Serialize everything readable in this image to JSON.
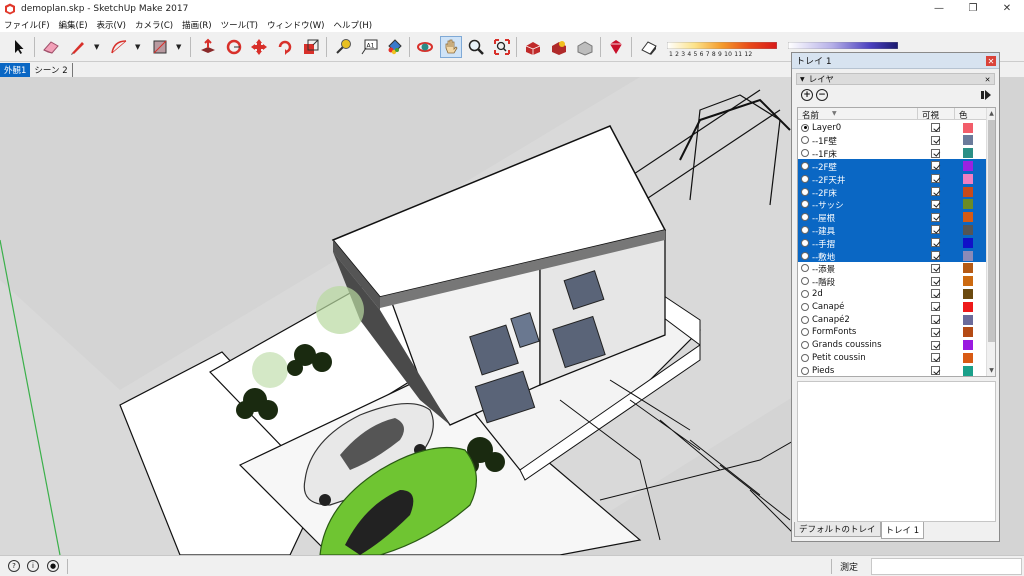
{
  "window": {
    "title": "demoplan.skp - SketchUp Make 2017",
    "app_icon": "sketchup-logo-icon",
    "controls": [
      "minimize-icon",
      "restore-icon",
      "close-icon"
    ]
  },
  "menu": [
    "ファイル(F)",
    "編集(E)",
    "表示(V)",
    "カメラ(C)",
    "描画(R)",
    "ツール(T)",
    "ウィンドウ(W)",
    "ヘルプ(H)"
  ],
  "toolbar": {
    "tools": [
      "select-icon",
      "eraser-icon",
      "line-pencil-icon",
      "arc-icon",
      "rectangle-icon",
      "push-pull-icon",
      "rotate-icon",
      "move-icon",
      "follow-me-icon",
      "scale-icon",
      "tape-measure-icon",
      "text-icon",
      "paint-bucket-icon",
      "orbit-icon",
      "pan-icon",
      "zoom-icon",
      "zoom-extents-icon",
      "3d-warehouse-icon",
      "extension-warehouse-icon",
      "share-model-icon",
      "ruby-console-icon",
      "shadow-toggle-icon"
    ],
    "shadow_scale_ticks": "1 2 3 4 5 6 7 8 9 10 11 12",
    "shadow_scale_colors": [
      "#ffffff",
      "#fce38a",
      "#f49a2a",
      "#e84a1a",
      "#d81a1a"
    ],
    "second_scale_colors": [
      "#ffffff",
      "#b6b0e8",
      "#4a3fbf",
      "#1a1a6e"
    ]
  },
  "scene_tabs": [
    {
      "label": "外観1",
      "active": true
    },
    {
      "label": "シーン 2",
      "active": false
    }
  ],
  "viewport": {
    "sky_color": "#d4d4d4",
    "ground_color": "#ffffff",
    "car_colors": {
      "sports_car": "#e8e8e8",
      "hatchback": "#6fc532"
    }
  },
  "tray": {
    "title": "トレイ 1",
    "panel_title": "レイヤ",
    "add_button": "+",
    "remove_button": "−",
    "columns": {
      "name": "名前",
      "visible": "可視",
      "color": "色"
    },
    "layers": [
      {
        "name": "Layer0",
        "active": true,
        "selected": false,
        "visible": true,
        "color": "#f25d6a"
      },
      {
        "name": "--1F壁",
        "active": false,
        "selected": false,
        "visible": true,
        "color": "#6b7b9b"
      },
      {
        "name": "--1F床",
        "active": false,
        "selected": false,
        "visible": true,
        "color": "#2a8f86"
      },
      {
        "name": "--2F壁",
        "active": false,
        "selected": true,
        "visible": true,
        "color": "#9a22e0"
      },
      {
        "name": "--2F天井",
        "active": false,
        "selected": true,
        "visible": true,
        "color": "#f07ec0"
      },
      {
        "name": "--2F床",
        "active": false,
        "selected": true,
        "visible": true,
        "color": "#c94a1a"
      },
      {
        "name": "--サッシ",
        "active": false,
        "selected": true,
        "visible": true,
        "color": "#6b8b26"
      },
      {
        "name": "--屋根",
        "active": false,
        "selected": true,
        "visible": true,
        "color": "#d45a14"
      },
      {
        "name": "--建具",
        "active": false,
        "selected": true,
        "visible": true,
        "color": "#555555"
      },
      {
        "name": "--手摺",
        "active": false,
        "selected": true,
        "visible": true,
        "color": "#1010c8"
      },
      {
        "name": "--敷地",
        "active": false,
        "selected": true,
        "visible": true,
        "color": "#8a8ab8"
      },
      {
        "name": "--添景",
        "active": false,
        "selected": false,
        "visible": true,
        "color": "#b55a14"
      },
      {
        "name": "--階段",
        "active": false,
        "selected": false,
        "visible": true,
        "color": "#cc6a10"
      },
      {
        "name": "2d",
        "active": false,
        "selected": false,
        "visible": true,
        "color": "#6b4a10"
      },
      {
        "name": "Canapé",
        "active": false,
        "selected": false,
        "visible": true,
        "color": "#ee1a1a"
      },
      {
        "name": "Canapé2",
        "active": false,
        "selected": false,
        "visible": true,
        "color": "#6b6b9b"
      },
      {
        "name": "FormFonts",
        "active": false,
        "selected": false,
        "visible": true,
        "color": "#b44a14"
      },
      {
        "name": "Grands coussins",
        "active": false,
        "selected": false,
        "visible": true,
        "color": "#9a1ae0"
      },
      {
        "name": "Petit coussin",
        "active": false,
        "selected": false,
        "visible": true,
        "color": "#d85a14"
      },
      {
        "name": "Pieds",
        "active": false,
        "selected": false,
        "visible": true,
        "color": "#1aa08a"
      }
    ],
    "bottom_tabs": [
      {
        "label": "デフォルトのトレイ",
        "active": false
      },
      {
        "label": "トレイ 1",
        "active": true
      }
    ]
  },
  "status": {
    "icons": [
      "geo-location-icon",
      "credits-icon",
      "user-account-icon"
    ],
    "measure_label": "測定",
    "measure_value": ""
  }
}
